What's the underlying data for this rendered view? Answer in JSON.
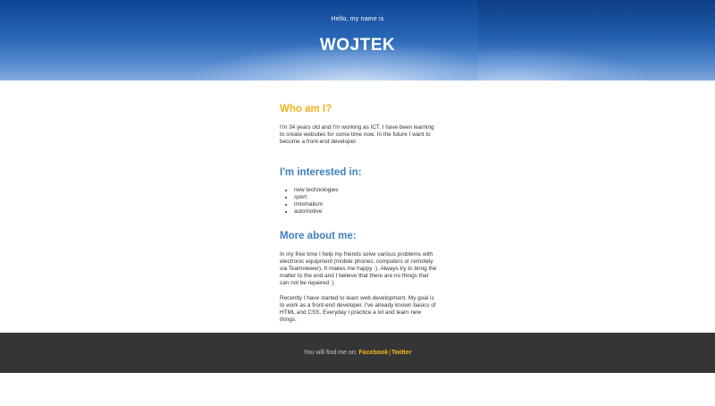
{
  "hero": {
    "greeting": "Hello, my name is",
    "name": "WOJTEK"
  },
  "who": {
    "heading": "Who am I?",
    "text": "I'm 34 years old and I'm working as ICT. I have been learning to create websites for some time now. In the future I want to become a front-end developer."
  },
  "interests": {
    "heading": "I'm interested in:",
    "items": [
      "new technologies",
      "sport",
      "minimalism",
      "automotive"
    ]
  },
  "more": {
    "heading": "More about me:",
    "paragraph1": "In my free time I help my friends solve various problems with electronic equipment (mobile phones, computers or remotely via Teamviewer). It makes me happy :). Always try to bring the matter to the end and I believe that there are no things that can not be repaired :)",
    "paragraph2": "Recently I have started to learn web development. My goal is to work as a front-end developer. I've already known basics of HTML and CSS. Everyday I practice a lot and learn new things."
  },
  "footer": {
    "prefix": "You will find me on:",
    "facebook": "Facebook",
    "separator": "|",
    "twitter": "Twitter"
  },
  "colors": {
    "accent_yellow": "#f2b01e",
    "accent_blue": "#3f7ec0",
    "footer_bg": "#353535"
  }
}
